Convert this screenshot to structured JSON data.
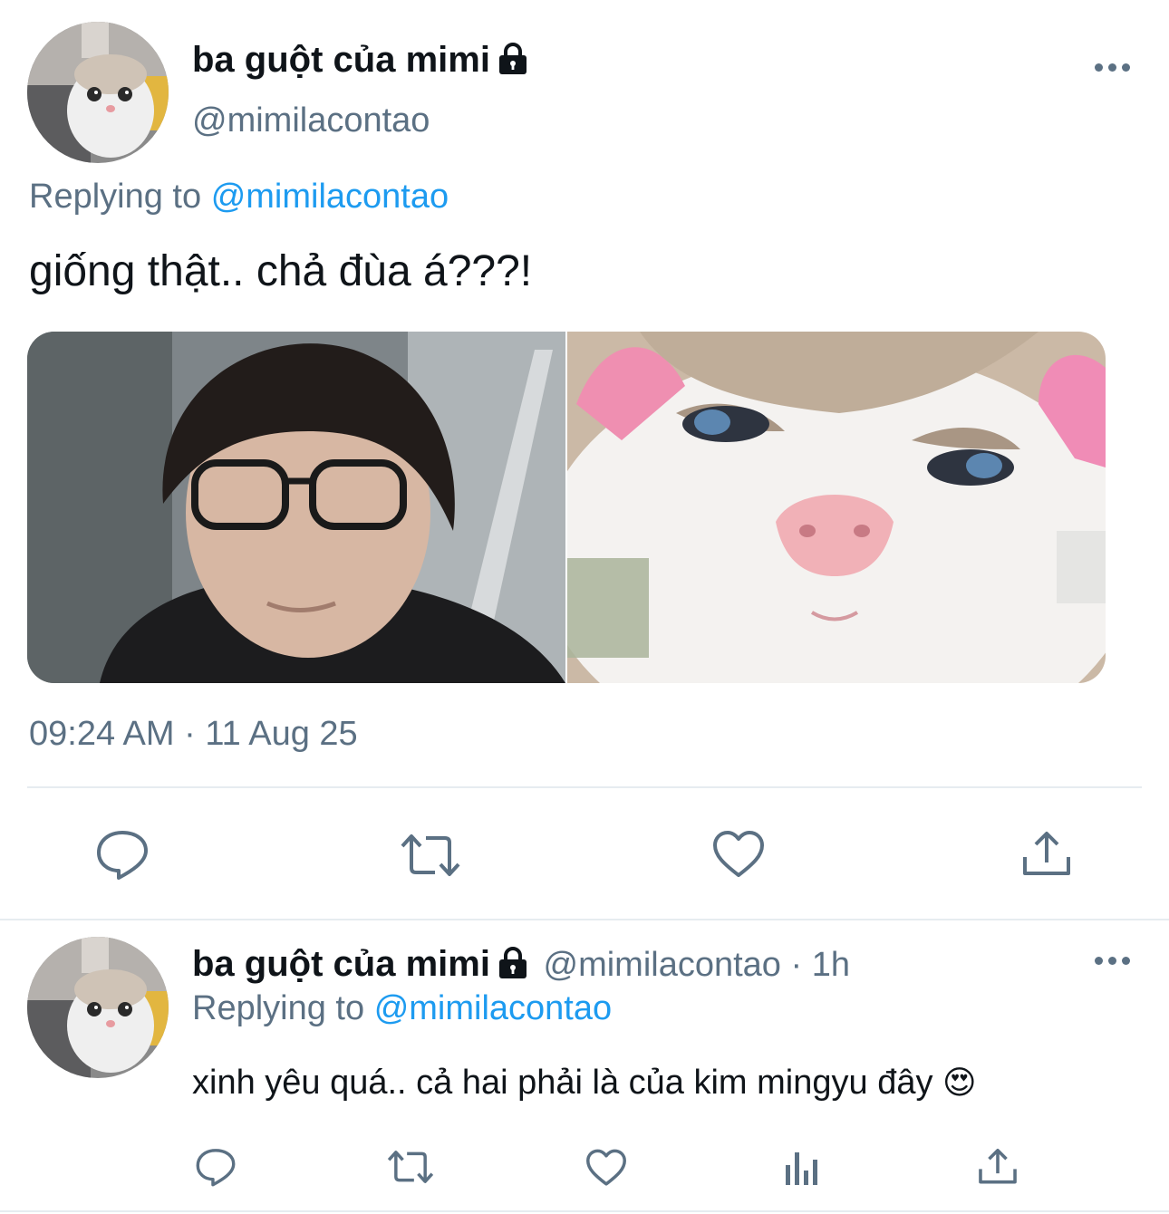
{
  "tweet": {
    "author_name": "ba guột của mimi",
    "author_handle": "@mimilacontao",
    "replying_to_label": "Replying to",
    "replying_to_handle": "@mimilacontao",
    "text": "giống thật.. chả đùa á???!",
    "timestamp": "09:24 AM · 11 Aug 25",
    "media": [
      {
        "icon": "photo-man-glasses"
      },
      {
        "icon": "photo-cat-closeup"
      }
    ],
    "actions": [
      "reply-icon",
      "retweet-icon",
      "like-icon",
      "share-icon"
    ]
  },
  "reply": {
    "author_name": "ba guột của mimi",
    "author_handle": "@mimilacontao",
    "time": "· 1h",
    "replying_to_label": "Replying to",
    "replying_to_handle": "@mimilacontao",
    "text": "xinh yêu quá.. cả hai phải là của kim mingyu đây",
    "emoji": "😍",
    "actions": [
      "reply-icon",
      "retweet-icon",
      "like-icon",
      "analytics-icon",
      "share-icon"
    ]
  },
  "colors": {
    "text": "#0f1419",
    "muted": "#5b7083",
    "link": "#1d9bf0",
    "divider": "#e6ecf0"
  }
}
